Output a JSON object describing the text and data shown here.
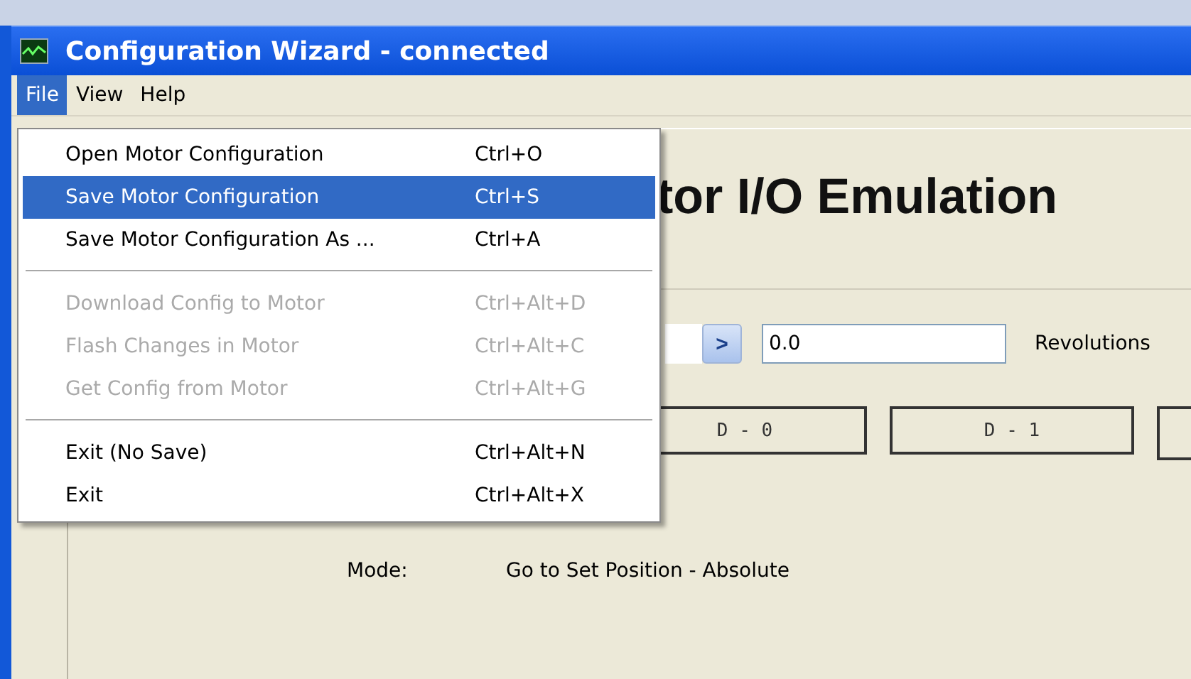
{
  "window": {
    "title": "Configuration Wizard - connected"
  },
  "menubar": [
    {
      "label": "File",
      "selected": true
    },
    {
      "label": "View",
      "selected": false
    },
    {
      "label": "Help",
      "selected": false
    }
  ],
  "file_menu": [
    {
      "kind": "item",
      "label": "Open Motor Configuration",
      "shortcut": "Ctrl+O",
      "disabled": false,
      "selected": false
    },
    {
      "kind": "item",
      "label": "Save Motor Configuration",
      "shortcut": "Ctrl+S",
      "disabled": false,
      "selected": true
    },
    {
      "kind": "item",
      "label": "Save Motor Configuration As ...",
      "shortcut": "Ctrl+A",
      "disabled": false,
      "selected": false
    },
    {
      "kind": "separator"
    },
    {
      "kind": "item",
      "label": "Download Config to Motor",
      "shortcut": "Ctrl+Alt+D",
      "disabled": true,
      "selected": false
    },
    {
      "kind": "item",
      "label": "Flash Changes in Motor",
      "shortcut": "Ctrl+Alt+C",
      "disabled": true,
      "selected": false
    },
    {
      "kind": "item",
      "label": "Get Config from Motor",
      "shortcut": "Ctrl+Alt+G",
      "disabled": true,
      "selected": false
    },
    {
      "kind": "separator"
    },
    {
      "kind": "item",
      "label": "Exit (No Save)",
      "shortcut": "Ctrl+Alt+N",
      "disabled": false,
      "selected": false
    },
    {
      "kind": "item",
      "label": "Exit",
      "shortcut": "Ctrl+Alt+X",
      "disabled": false,
      "selected": false
    }
  ],
  "heading": "tor I/O Emulation",
  "position": {
    "step_button": ">",
    "value": "0.0",
    "unit": "Revolutions"
  },
  "digital_buttons": [
    {
      "label": "D - 0"
    },
    {
      "label": "D - 1"
    },
    {
      "kind": "cut"
    }
  ],
  "mode": {
    "label": "Mode:",
    "value": "Go to Set Position - Absolute"
  }
}
